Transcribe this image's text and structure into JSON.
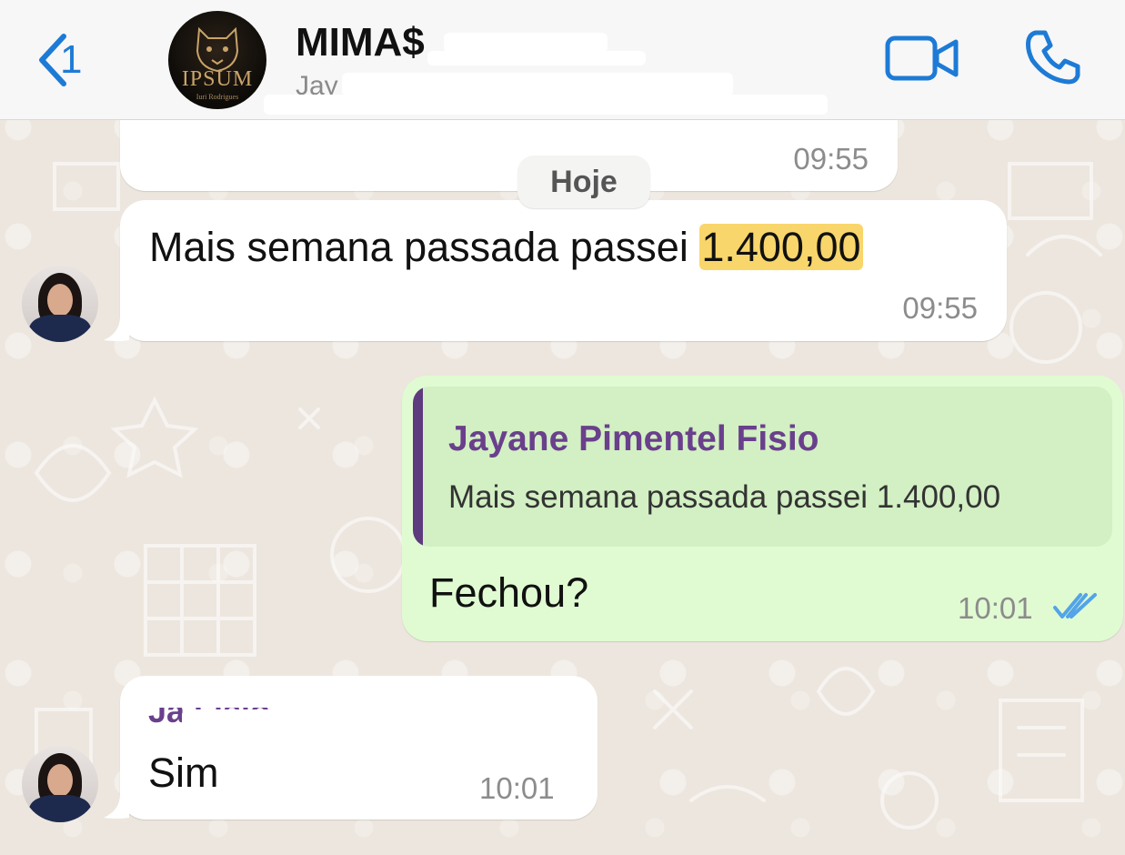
{
  "header": {
    "back_count": "1",
    "title": "MIMA$",
    "subtitle": "Jay",
    "avatar_logo_text": "IPSUM",
    "avatar_logo_small": "Iuri Rodrigues"
  },
  "date_divider": "Hoje",
  "messages": [
    {
      "text": "",
      "time": "09:55"
    },
    {
      "text_before": "Mais semana passada passei ",
      "text_highlight": "1.400,00",
      "time": "09:55"
    },
    {
      "quote_author": "Jayane Pimentel Fisio",
      "quote_text": "Mais semana passada passei 1.400,00",
      "text": "Fechou?",
      "time": "10:01"
    },
    {
      "sender": "Ja            Fisio",
      "text": "Sim",
      "time": "10:01"
    }
  ],
  "colors": {
    "accent": "#1d7bd6",
    "outgoing_bubble": "#e0fbd2",
    "quote_bar": "#5e3a7e",
    "highlight": "#f9d66b",
    "read_ticks": "#53a4e8"
  },
  "icons": [
    "chevron-left-icon",
    "video-camera-icon",
    "phone-icon",
    "double-check-icon"
  ]
}
